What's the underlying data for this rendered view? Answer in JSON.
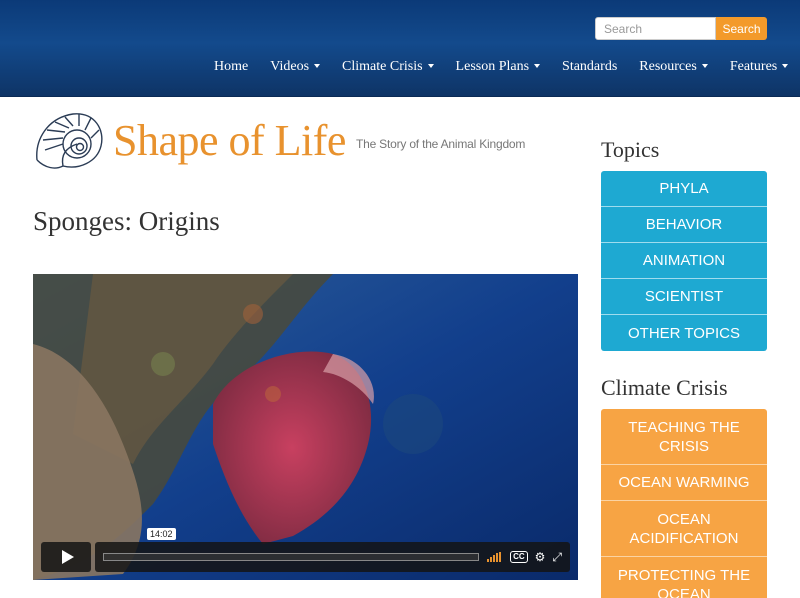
{
  "header": {
    "search": {
      "placeholder": "Search",
      "button_label": "Search"
    },
    "nav": [
      {
        "label": "Home",
        "dropdown": false
      },
      {
        "label": "Videos",
        "dropdown": true
      },
      {
        "label": "Climate Crisis",
        "dropdown": true
      },
      {
        "label": "Lesson Plans",
        "dropdown": true
      },
      {
        "label": "Standards",
        "dropdown": false
      },
      {
        "label": "Resources",
        "dropdown": true
      },
      {
        "label": "Features",
        "dropdown": true
      }
    ]
  },
  "logo": {
    "title": "Shape of Life",
    "tagline": "The Story of the Animal Kingdom",
    "icon": "nautilus-shell-icon"
  },
  "page": {
    "title": "Sponges: Origins"
  },
  "video": {
    "duration_badge": "14:02",
    "controls": [
      "play-icon",
      "volume-icon",
      "cc-icon",
      "settings-icon",
      "fullscreen-icon"
    ]
  },
  "sidebar": {
    "topics_heading": "Topics",
    "topics": [
      "PHYLA",
      "BEHAVIOR",
      "ANIMATION",
      "SCIENTIST",
      "OTHER TOPICS"
    ],
    "climate_heading": "Climate Crisis",
    "climate": [
      "TEACHING THE CRISIS",
      "OCEAN WARMING",
      "OCEAN ACIDIFICATION",
      "PROTECTING THE OCEAN"
    ]
  },
  "colors": {
    "header": "#134a8c",
    "accent_orange": "#f39a2a",
    "topics_blue": "#1ea9d2",
    "climate_orange": "#f7a444",
    "logo_orange": "#e8922e"
  }
}
